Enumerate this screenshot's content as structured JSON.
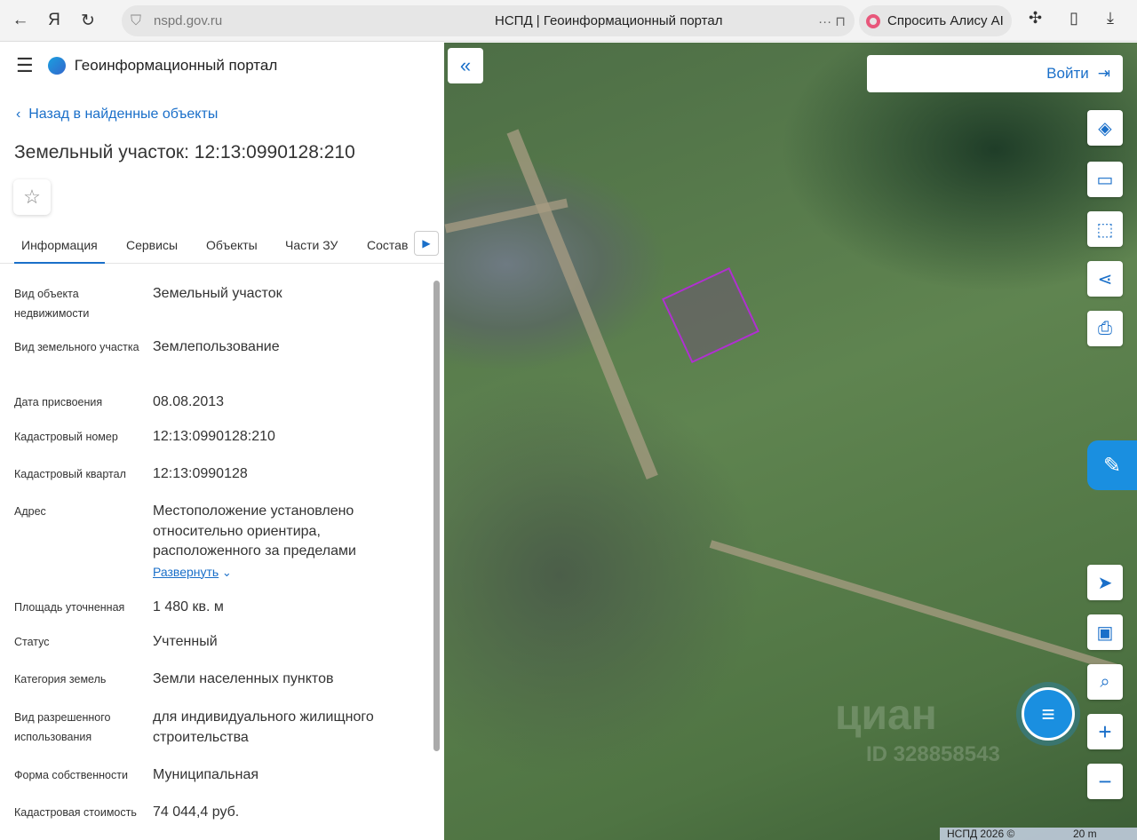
{
  "browser": {
    "url": "nspd.gov.ru",
    "page_title": "НСПД | Геоинформационный портал",
    "alice_label": "Спросить Алису AI"
  },
  "header": {
    "brand": "Геоинформационный портал"
  },
  "back_link": "Назад в найденные объекты",
  "title": "Земельный участок: 12:13:0990128:210",
  "tabs": [
    "Информация",
    "Сервисы",
    "Объекты",
    "Части ЗУ",
    "Состав"
  ],
  "fields": [
    {
      "label": "Вид объекта недвижимости",
      "value": "Земельный участок"
    },
    {
      "label": "Вид земельного участка",
      "value": "Землепользование"
    },
    {
      "label": "Дата присвоения",
      "value": "08.08.2013"
    },
    {
      "label": "Кадастровый номер",
      "value": "12:13:0990128:210"
    },
    {
      "label": "Кадастровый квартал",
      "value": "12:13:0990128"
    },
    {
      "label": "Адрес",
      "value": "Местоположение установлено относительно ориентира, расположенного за пределами"
    },
    {
      "label": "Площадь уточненная",
      "value": "1 480 кв. м"
    },
    {
      "label": "Статус",
      "value": "Учтенный"
    },
    {
      "label": "Категория земель",
      "value": "Земли населенных пунктов"
    },
    {
      "label": "Вид разрешенного использования",
      "value": "для индивидуального жилищного строительства"
    },
    {
      "label": "Форма собственности",
      "value": "Муниципальная"
    },
    {
      "label": "Кадастровая стоимость",
      "value": "74 044,4 руб."
    }
  ],
  "expand_label": "Развернуть",
  "map": {
    "login_label": "Войти",
    "watermark": "циан",
    "watermark_id": "ID 328858543",
    "attribution": "НСПД 2026 ©",
    "scale": "20 m"
  }
}
